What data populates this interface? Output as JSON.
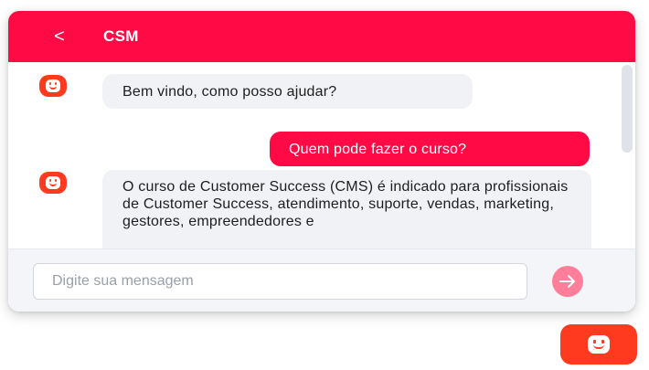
{
  "header": {
    "back_label": "<",
    "title": "CSM"
  },
  "messages": [
    {
      "from": "bot",
      "text": "Bem vindo, como posso ajudar?"
    },
    {
      "from": "user",
      "text": "Quem pode fazer o curso?"
    },
    {
      "from": "bot",
      "text": "O curso de Customer Success (CMS) é indicado para profissionais de Customer Success, atendimento, suporte, vendas, marketing, gestores, empreendedores e"
    }
  ],
  "composer": {
    "placeholder": "Digite sua mensagem",
    "send_icon": "arrow-right-icon"
  },
  "launcher": {
    "icon": "bot-face-icon"
  },
  "colors": {
    "brand": "#ff0a45",
    "avatar": "#ff3a1f",
    "send_disabled": "#ff7f9a",
    "bot_bubble": "#f0f2f6"
  }
}
